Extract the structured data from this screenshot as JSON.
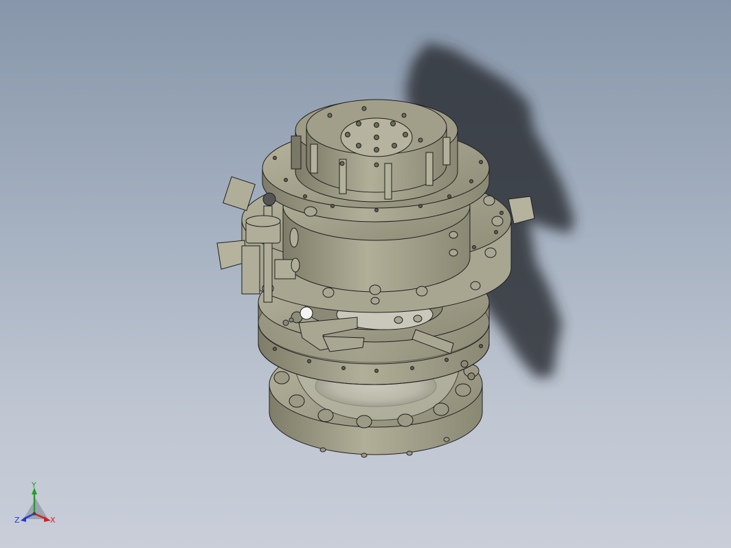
{
  "viewport": {
    "background_top": "#8796aa",
    "background_bottom": "#c9ced9",
    "model_body_color": "#a3a18b",
    "model_edge_color": "#1e1e1e",
    "shadow_color": "#2e3238"
  },
  "triad": {
    "x_label": "X",
    "y_label": "Y",
    "z_label": "Z",
    "x_color": "#d12020",
    "y_color": "#22a02a",
    "z_color": "#2438d0"
  }
}
